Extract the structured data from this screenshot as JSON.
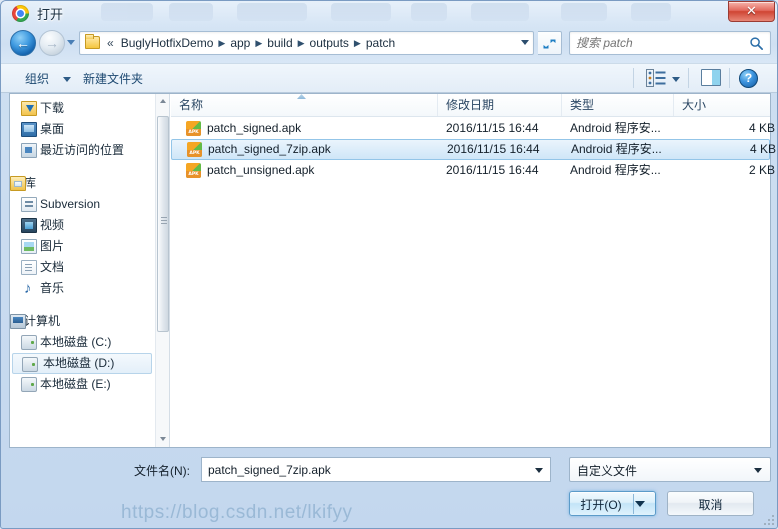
{
  "window": {
    "title": "打开",
    "title_icon": "chrome-logo-icon",
    "close_label": "✕"
  },
  "nav": {
    "back_label": "←",
    "forward_label": "→",
    "history_dropdown_icon": "chevron-down-icon",
    "refresh_icon": "refresh-icon"
  },
  "address": {
    "folder_icon": "folder-icon",
    "overflow": "«",
    "separator": "▶",
    "crumbs": [
      "BuglyHotfixDemo",
      "app",
      "build",
      "outputs",
      "patch"
    ],
    "dropdown_icon": "chevron-down-icon"
  },
  "search": {
    "placeholder": "搜索 patch",
    "icon": "search-icon"
  },
  "toolbar": {
    "organize": "组织",
    "organize_caret": "chevron-down-icon",
    "new_folder": "新建文件夹",
    "view_icon": "list-view-icon",
    "view_caret": "chevron-down-icon",
    "preview_pane_icon": "preview-pane-icon",
    "help_icon": "help-icon",
    "help_label": "?"
  },
  "sidebar": {
    "items": [
      {
        "label": "下载",
        "icon": "download-icon",
        "level": 1,
        "selected": false
      },
      {
        "label": "桌面",
        "icon": "desktop-icon",
        "level": 1,
        "selected": false
      },
      {
        "label": "最近访问的位置",
        "icon": "recent-icon",
        "level": 1,
        "selected": false
      },
      {
        "label": "",
        "icon": "spacer",
        "level": 1,
        "selected": false
      },
      {
        "label": "库",
        "icon": "library-icon",
        "level": 0,
        "selected": false
      },
      {
        "label": "Subversion",
        "icon": "subversion-icon",
        "level": 1,
        "selected": false
      },
      {
        "label": "视频",
        "icon": "video-icon",
        "level": 1,
        "selected": false
      },
      {
        "label": "图片",
        "icon": "picture-icon",
        "level": 1,
        "selected": false
      },
      {
        "label": "文档",
        "icon": "document-icon",
        "level": 1,
        "selected": false
      },
      {
        "label": "音乐",
        "icon": "music-icon",
        "level": 1,
        "selected": false
      },
      {
        "label": "",
        "icon": "spacer",
        "level": 1,
        "selected": false
      },
      {
        "label": "计算机",
        "icon": "computer-icon",
        "level": 0,
        "selected": false
      },
      {
        "label": "本地磁盘 (C:)",
        "icon": "drive-icon",
        "level": 1,
        "selected": false
      },
      {
        "label": "本地磁盘 (D:)",
        "icon": "drive-icon",
        "level": 1,
        "selected": true
      },
      {
        "label": "本地磁盘 (E:)",
        "icon": "drive-icon",
        "level": 1,
        "selected": false
      }
    ]
  },
  "filelist": {
    "columns": [
      "名称",
      "修改日期",
      "类型",
      "大小"
    ],
    "sorted_column": "名称",
    "rows": [
      {
        "name": "patch_signed.apk",
        "date": "2016/11/15 16:44",
        "type": "Android 程序安...",
        "size": "4 KB",
        "icon": "apk-file-icon",
        "selected": false
      },
      {
        "name": "patch_signed_7zip.apk",
        "date": "2016/11/15 16:44",
        "type": "Android 程序安...",
        "size": "4 KB",
        "icon": "apk-file-icon",
        "selected": true
      },
      {
        "name": "patch_unsigned.apk",
        "date": "2016/11/15 16:44",
        "type": "Android 程序安...",
        "size": "2 KB",
        "icon": "apk-file-icon",
        "selected": false
      }
    ]
  },
  "footer": {
    "filename_label": "文件名(N):",
    "filename_value": "patch_signed_7zip.apk",
    "filename_caret": "chevron-down-icon",
    "filetype_value": "自定义文件",
    "filetype_caret": "chevron-down-icon",
    "open_label": "打开(O)",
    "open_caret": "chevron-down-icon",
    "cancel_label": "取消"
  },
  "watermark": {
    "text": "https://blog.csdn.net/lkifyy"
  },
  "colors": {
    "selection_blue": "#cfe6f8",
    "selection_border": "#93c5e8",
    "close_red": "#cf4433",
    "accent_blue": "#1e4a72"
  }
}
